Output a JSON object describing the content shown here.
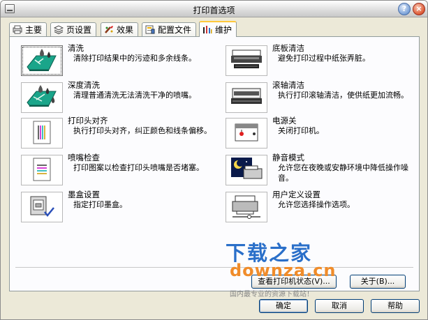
{
  "window": {
    "title": "打印首选项"
  },
  "tabs": [
    {
      "label": "主要",
      "icon": "main-tab-icon"
    },
    {
      "label": "页设置",
      "icon": "page-setup-icon"
    },
    {
      "label": "效果",
      "icon": "effects-icon"
    },
    {
      "label": "配置文件",
      "icon": "profile-icon"
    },
    {
      "label": "维护",
      "icon": "maintenance-icon",
      "active": true
    }
  ],
  "maintenance": {
    "left": [
      {
        "title": "清洗",
        "desc": "清除打印结果中的污迹和多余线条。",
        "icon": "cleaning-icon"
      },
      {
        "title": "深度清洗",
        "desc": "清理普通清洗无法清洗干净的喷嘴。",
        "icon": "deep-cleaning-icon"
      },
      {
        "title": "打印头对齐",
        "desc": "执行打印头对齐，纠正颜色和线条偏移。",
        "icon": "print-head-alignment-icon"
      },
      {
        "title": "喷嘴检查",
        "desc": "打印图案以检查打印头喷嘴是否堵塞。",
        "icon": "nozzle-check-icon"
      },
      {
        "title": "墨盒设置",
        "desc": "指定打印墨盒。",
        "icon": "ink-cartridge-icon"
      }
    ],
    "right": [
      {
        "title": "底板清洁",
        "desc": "避免打印过程中纸张弄脏。",
        "icon": "bottom-plate-cleaning-icon"
      },
      {
        "title": "滚轴清洁",
        "desc": "执行打印滚轴清洁，使供纸更加流畅。",
        "icon": "roller-cleaning-icon"
      },
      {
        "title": "电源关",
        "desc": "关闭打印机。",
        "icon": "power-off-icon"
      },
      {
        "title": "静音模式",
        "desc": "允许您在夜晚或安静环境中降低操作噪音。",
        "icon": "quiet-mode-icon"
      },
      {
        "title": "用户定义设置",
        "desc": "允许您选择操作选项。",
        "icon": "custom-settings-icon"
      }
    ]
  },
  "panel_buttons": {
    "status": "查看打印机状态(V)...",
    "about": "关于(B)..."
  },
  "footer_buttons": {
    "ok": "确定",
    "cancel": "取消",
    "help": "帮助"
  },
  "watermark": {
    "line1": "下载之家",
    "line2": "downza.cn",
    "line3": "国内最专业的资源下载站！"
  },
  "colors": {
    "tab_highlight": "#ffc83c",
    "button_border": "#003c74",
    "watermark_blue": "#2a6fc9",
    "watermark_orange": "#f08c2a"
  }
}
